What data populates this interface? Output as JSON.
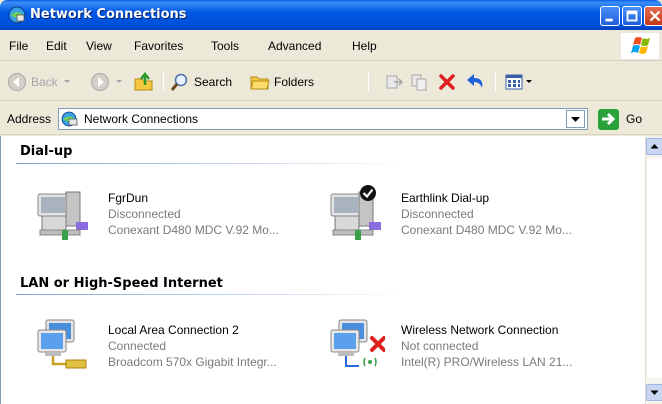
{
  "window": {
    "title": "Network Connections"
  },
  "menu": {
    "items": [
      "File",
      "Edit",
      "View",
      "Favorites",
      "Tools",
      "Advanced",
      "Help"
    ]
  },
  "toolbar": {
    "back_label": "Back",
    "search_label": "Search",
    "folders_label": "Folders"
  },
  "address": {
    "label": "Address",
    "value": "Network Connections",
    "go_label": "Go"
  },
  "groups": [
    {
      "title": "Dial-up",
      "connections": [
        {
          "name": "FgrDun",
          "status": "Disconnected",
          "device": "Conexant D480 MDC V.92 Mo...",
          "icon": "dialup-icon",
          "default": false
        },
        {
          "name": "Earthlink Dial-up",
          "status": "Disconnected",
          "device": "Conexant D480 MDC V.92 Mo...",
          "icon": "dialup-icon",
          "default": true
        }
      ]
    },
    {
      "title": "LAN or High-Speed Internet",
      "connections": [
        {
          "name": "Local Area Connection 2",
          "status": "Connected",
          "device": "Broadcom 570x Gigabit Integr...",
          "icon": "lan-icon"
        },
        {
          "name": "Wireless Network Connection",
          "status": "Not connected",
          "device": "Intel(R) PRO/Wireless LAN 21...",
          "icon": "wireless-icon"
        }
      ]
    }
  ],
  "colors": {
    "titlebar": "#0058e6",
    "chrome": "#ece9d8",
    "subtext": "#7a7a7a",
    "group_line": "#7fa0d8"
  }
}
